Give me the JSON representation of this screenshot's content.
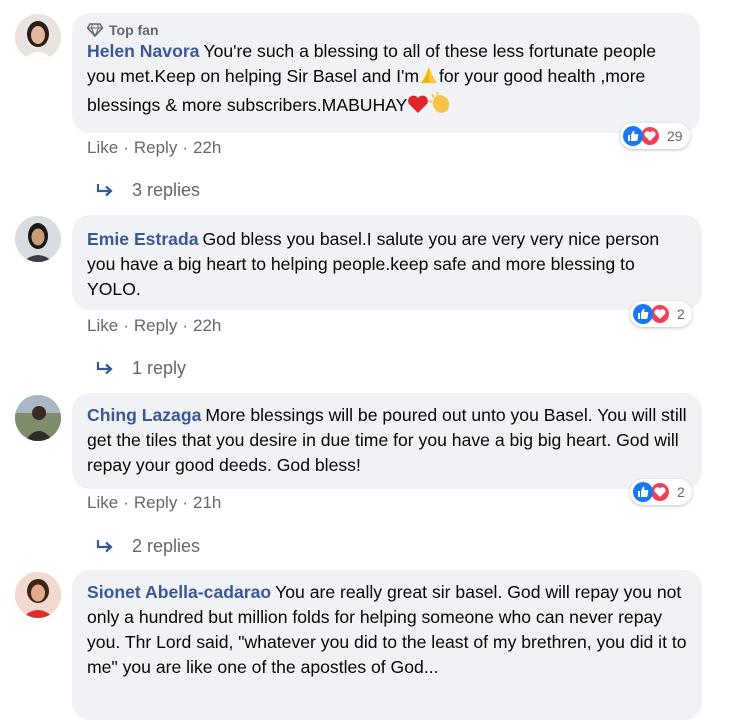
{
  "comments": [
    {
      "badge": "Top fan",
      "author": "Helen Navora",
      "text_part1": "You're such a blessing to all of these less fortunate people you met.Keep on helping Sir Basel and I'm",
      "text_part2": "for your good health ,more blessings & more subscribers.MABUHAY",
      "like": "Like",
      "reply": "Reply",
      "time": "22h",
      "reaction_count": "29",
      "replies": "3 replies"
    },
    {
      "author": "Emie Estrada",
      "text": "God bless you basel.I salute you are very very nice person you have a big heart to helping people.keep safe and more blessing to YOLO.",
      "like": "Like",
      "reply": "Reply",
      "time": "22h",
      "reaction_count": "2",
      "replies": "1 reply"
    },
    {
      "author": "Ching Lazaga",
      "text": "More blessings will be poured out unto you Basel. You will still get the tiles that you desire in due time for you have a big big heart. God will repay your good deeds. God bless!",
      "like": "Like",
      "reply": "Reply",
      "time": "21h",
      "reaction_count": "2",
      "replies": "2 replies"
    },
    {
      "author": "Sionet Abella-cadarao",
      "text": "You are really great sir basel. God will repay you not only a hundred but million folds for helping someone who can never repay you. Thr Lord said, \"whatever you did to the least of my brethren, you did it to me\" you are like one of the apostles of God..."
    }
  ],
  "icons": {
    "badge": "diamond-icon",
    "reply_arrow": "reply-arrow-icon",
    "like_reaction": "like-reaction-icon",
    "love_reaction": "love-reaction-icon",
    "emoji1": "folded-hands-emoji",
    "emoji2": "red-heart-emoji",
    "emoji3": "clapping-hands-emoji"
  },
  "colors": {
    "author": "#385898",
    "bubble": "#f0f2f5",
    "meta": "#65676b",
    "like": "#1877f2",
    "love": "#f33e58"
  }
}
